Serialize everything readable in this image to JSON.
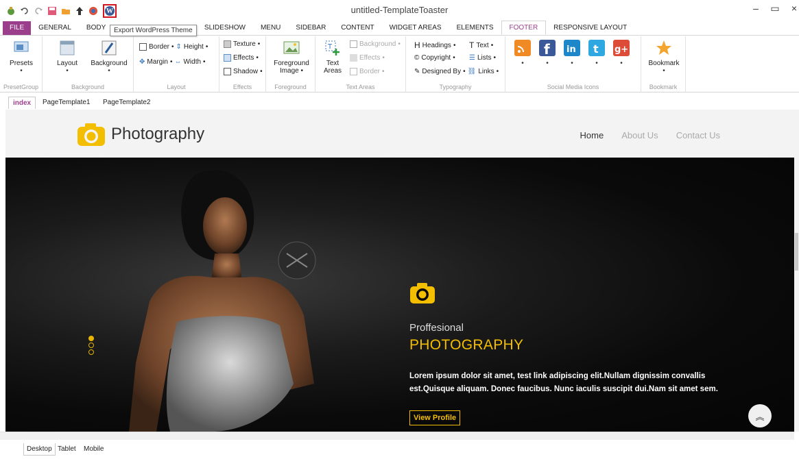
{
  "window": {
    "title": "untitled-TemplateToaster",
    "tooltip": "Export WordPress Theme"
  },
  "ribbon_tabs": [
    "FILE",
    "GENERAL",
    "BODY",
    "SLIDESHOW",
    "MENU",
    "SIDEBAR",
    "CONTENT",
    "WIDGET AREAS",
    "ELEMENTS",
    "FOOTER",
    "RESPONSIVE LAYOUT"
  ],
  "active_ribbon_tab": "FOOTER",
  "ribbon": {
    "presets": {
      "label": "Presets",
      "group": "PresetGroup"
    },
    "background": {
      "layout_label": "Layout",
      "bg_label": "Background",
      "group": "Background"
    },
    "layout": {
      "border": "Border",
      "height": "Height",
      "margin": "Margin",
      "width": "Width",
      "group": "Layout"
    },
    "effects": {
      "texture": "Texture",
      "effects": "Effects",
      "shadow": "Shadow",
      "group": "Effects"
    },
    "foreground": {
      "label_line1": "Foreground",
      "label_line2": "Image",
      "group": "Foreground"
    },
    "text_areas": {
      "label_line1": "Text",
      "label_line2": "Areas",
      "background": "Background",
      "effects": "Effects",
      "border": "Border",
      "group": "Text Areas"
    },
    "typography": {
      "headings": "Headings",
      "text": "Text",
      "copyright": "Copyright",
      "lists": "Lists",
      "designed_by": "Designed By",
      "links": "Links",
      "group": "Typography"
    },
    "social": {
      "group": "Social Media Icons"
    },
    "bookmark": {
      "label": "Bookmark",
      "group": "Bookmark"
    }
  },
  "doc_tabs": [
    "index",
    "PageTemplate1",
    "PageTemplate2"
  ],
  "site": {
    "logo_text": "Photography",
    "nav": [
      "Home",
      "About Us",
      "Contact Us"
    ],
    "hero_sub": "Proffesional",
    "hero_title": "PHOTOGRAPHY",
    "hero_body": "Lorem ipsum dolor sit amet, test link adipiscing elit.Nullam dignissim convallis est.Quisque aliquam. Donec faucibus. Nunc iaculis suscipit dui.Nam sit amet sem.",
    "hero_button": "View Profile"
  },
  "view_tabs": [
    "Desktop",
    "Tablet",
    "Mobile"
  ],
  "colors": {
    "accent": "#9b3f8d",
    "brand_yellow": "#f4be00"
  }
}
